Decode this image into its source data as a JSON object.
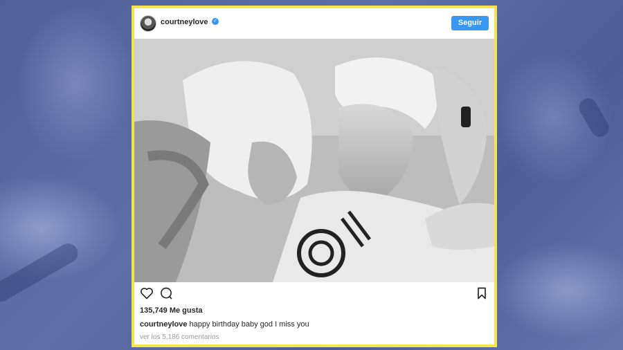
{
  "post": {
    "username": "courtneylove",
    "verified": true,
    "follow_label": "Seguir",
    "likes": "135,749 Me gusta",
    "caption_user": "courtneylove",
    "caption_text": "happy birthday baby god I miss you",
    "comments_link": "ver los 5,186 comentarios"
  },
  "icons": {
    "verified": "verified-badge-icon",
    "like": "heart-icon",
    "comment": "comment-icon",
    "save": "bookmark-icon"
  },
  "colors": {
    "frame": "#f4e64a",
    "accent": "#3897f0",
    "background": "#5a6ba3"
  }
}
